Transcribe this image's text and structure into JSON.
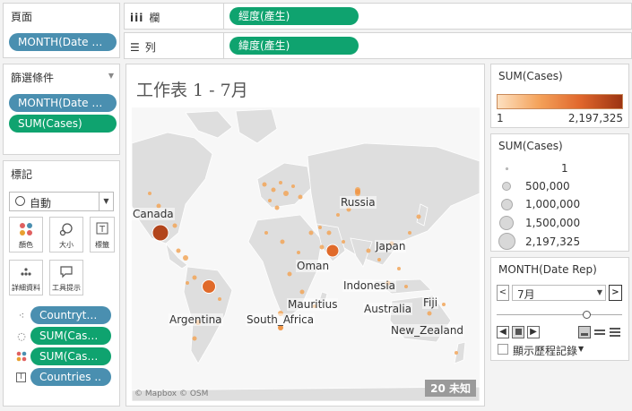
{
  "pages_card": {
    "title": "頁面",
    "pill": "MONTH(Date Re.."
  },
  "shelves": {
    "columns": {
      "label": "欄",
      "pill": "經度(產生)"
    },
    "rows": {
      "label": "列",
      "pill": "緯度(產生)"
    }
  },
  "filters_card": {
    "title": "篩選條件",
    "items": [
      "MONTH(Date Re..",
      "SUM(Cases)"
    ]
  },
  "marks_card": {
    "title": "標記",
    "mark_type": "自動",
    "buttons": {
      "color": "顏色",
      "size": "大小",
      "label": "標籤",
      "detail": "詳細資料",
      "tooltip": "工具提示"
    },
    "fields": [
      "Countryter..",
      "SUM(Cases)",
      "SUM(Cases)",
      "Countries .."
    ]
  },
  "sheet": {
    "title": "工作表 1 - 7月",
    "attribution": "© Mapbox © OSM",
    "unknown_badge": "20 未知",
    "labels": [
      "Canada",
      "Russia",
      "Japan",
      "Oman",
      "Indonesia",
      "Mauritius",
      "Argentina",
      "South_Africa",
      "Australia",
      "Fiji",
      "New_Zealand"
    ]
  },
  "color_legend": {
    "title": "SUM(Cases)",
    "min": "1",
    "max": "2,197,325",
    "gradient": [
      "#fde0c0",
      "#f4a25a",
      "#e0662c",
      "#9c3412"
    ]
  },
  "size_legend": {
    "title": "SUM(Cases)",
    "items": [
      "1",
      "500,000",
      "1,000,000",
      "1,500,000",
      "2,197,325"
    ]
  },
  "page_control": {
    "title": "MONTH(Date Rep)",
    "value": "7月",
    "history_label": "顯示歷程記錄"
  }
}
